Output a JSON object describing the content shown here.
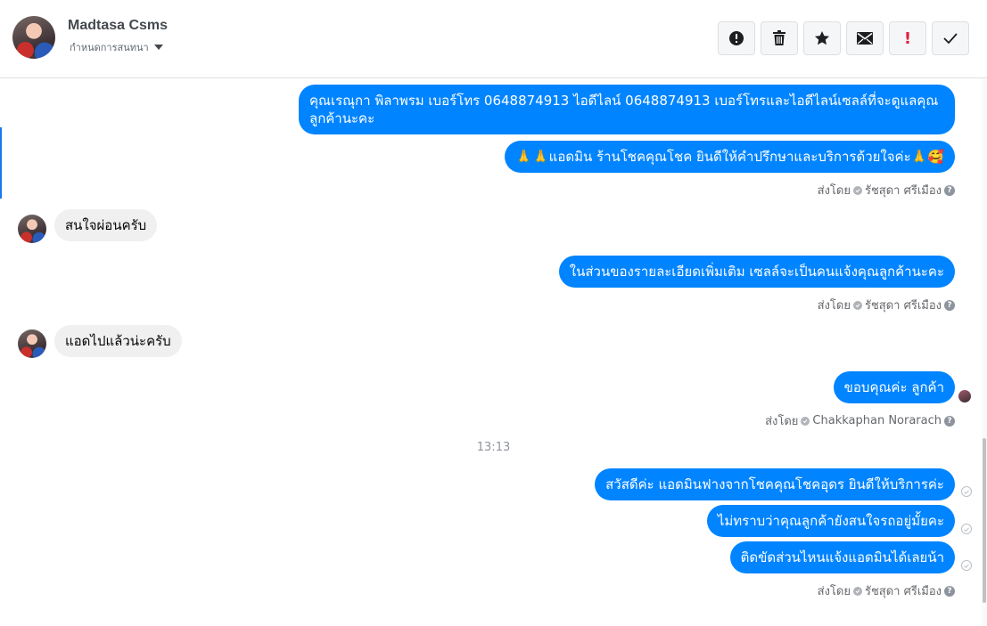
{
  "header": {
    "name": "Madtasa Csms",
    "subtitle": "กำหนดการสนทนา",
    "tools": [
      "alert-icon",
      "trash-icon",
      "star-icon",
      "envelope-icon",
      "exclamation-icon",
      "check-icon"
    ],
    "exclamation_text": "!"
  },
  "messages": [
    {
      "text": "คุณเรณุกา พิลาพรม        เบอร์โทร 0648874913  ไอดีไลน์ 0648874913   เบอร์โทรและไอดีไลน์เซลล์ที่จะดูแลคุณลูกค้านะคะ"
    },
    {
      "text": "🙏🙏แอดมิน ร้านโชคคุณโชค ยินดีให้คำปรึกษาและบริการด้วยใจค่ะ🙏🥰"
    },
    {
      "text": "สนใจผ่อนครับ"
    },
    {
      "text": "ในส่วนของรายละเอียดเพิ่มเติม เซลล์จะเป็นคนแจ้งคุณลูกค้านะคะ"
    },
    {
      "text": "แอดไปแล้วน่ะครับ"
    },
    {
      "text": "ขอบคุณค่ะ ลูกค้า"
    },
    {
      "text": "สวัสดีค่ะ แอดมินฟางจากโชคคุณโชคอุดร ยินดีให้บริการค่ะ"
    },
    {
      "text": "ไม่ทราบว่าคุณลูกค้ายังสนใจรถอยู่มั้ยคะ"
    },
    {
      "text": "ติดขัดส่วนไหนแจ้งแอดมินได้เลยน้า"
    }
  ],
  "sent_by": [
    {
      "prefix": "ส่งโดย",
      "name": "รัชสุดา ศรีเมือง"
    },
    {
      "prefix": "ส่งโดย",
      "name": "รัชสุดา ศรีเมือง"
    },
    {
      "prefix": "ส่งโดย",
      "name": "Chakkaphan Norarach"
    },
    {
      "prefix": "ส่งโดย",
      "name": "รัชสุดา ศรีเมือง"
    }
  ],
  "timestamp": "13:13",
  "help_glyph": "?",
  "colors": {
    "outgoing_bubble": "#0084ff",
    "incoming_bubble": "#f0f0f0",
    "accent": "#1877f2"
  }
}
